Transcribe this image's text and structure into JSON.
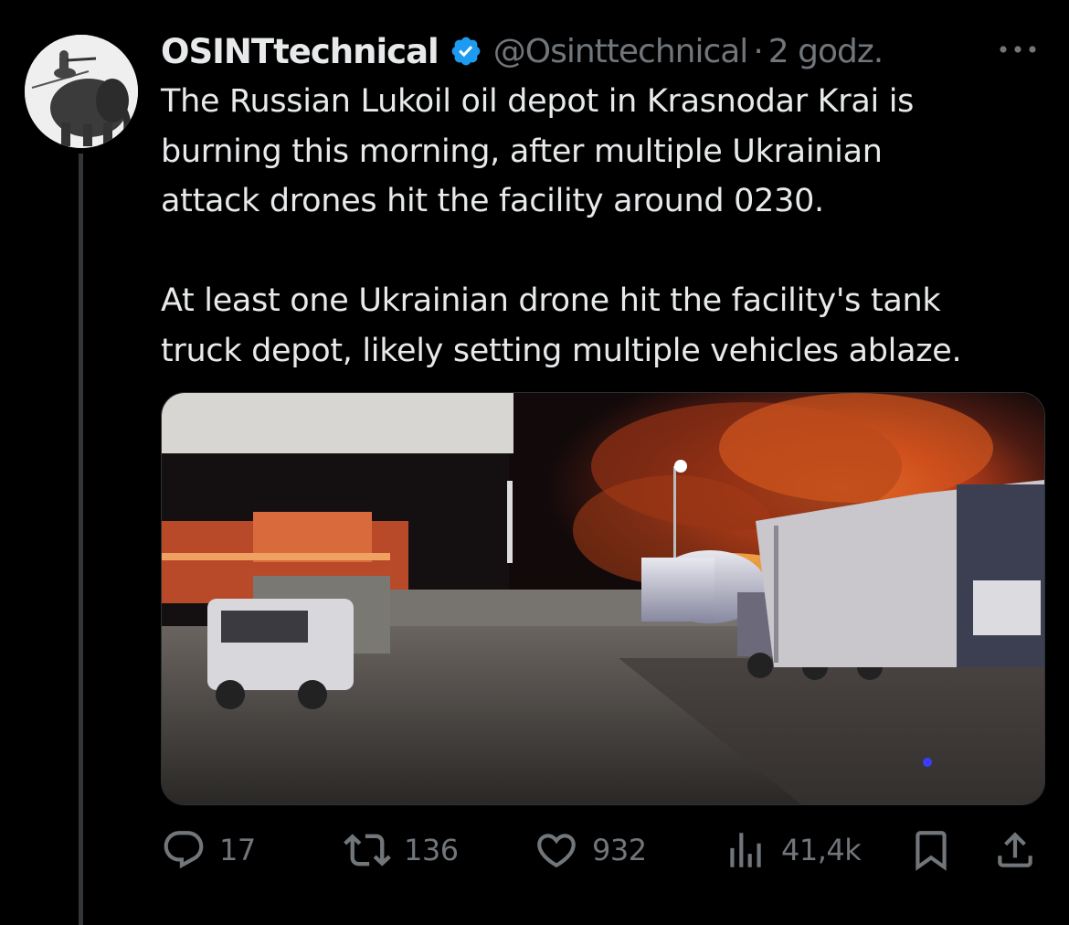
{
  "author": {
    "name": "OSINTtechnical",
    "handle": "@Osinttechnical",
    "separator": "·",
    "time": "2 godz.",
    "verified": true,
    "avatar_icon": "elephant-with-soldier-avatar"
  },
  "tweet": {
    "lines_para1": [
      "The Russian Lukoil oil depot in Krasnodar Krai is",
      "burning this morning, after multiple Ukrainian",
      "attack drones hit the facility around 0230."
    ],
    "lines_para2": [
      "At least one Ukrainian drone hit the facility's tank",
      "truck depot, likely setting multiple vehicles ablaze."
    ]
  },
  "media": {
    "icon": "photo-burning-oil-depot"
  },
  "actions": {
    "reply": {
      "icon": "reply-icon",
      "count": "17"
    },
    "retweet": {
      "icon": "retweet-icon",
      "count": "136"
    },
    "like": {
      "icon": "heart-icon",
      "count": "932"
    },
    "views": {
      "icon": "views-icon",
      "count": "41,4k"
    },
    "bookmark": {
      "icon": "bookmark-icon"
    },
    "share": {
      "icon": "share-icon"
    }
  },
  "colors": {
    "background": "#000000",
    "text": "#e7e9ea",
    "muted": "#71767b",
    "verified_blue": "#1d9bf0",
    "thread_line": "#333639"
  }
}
